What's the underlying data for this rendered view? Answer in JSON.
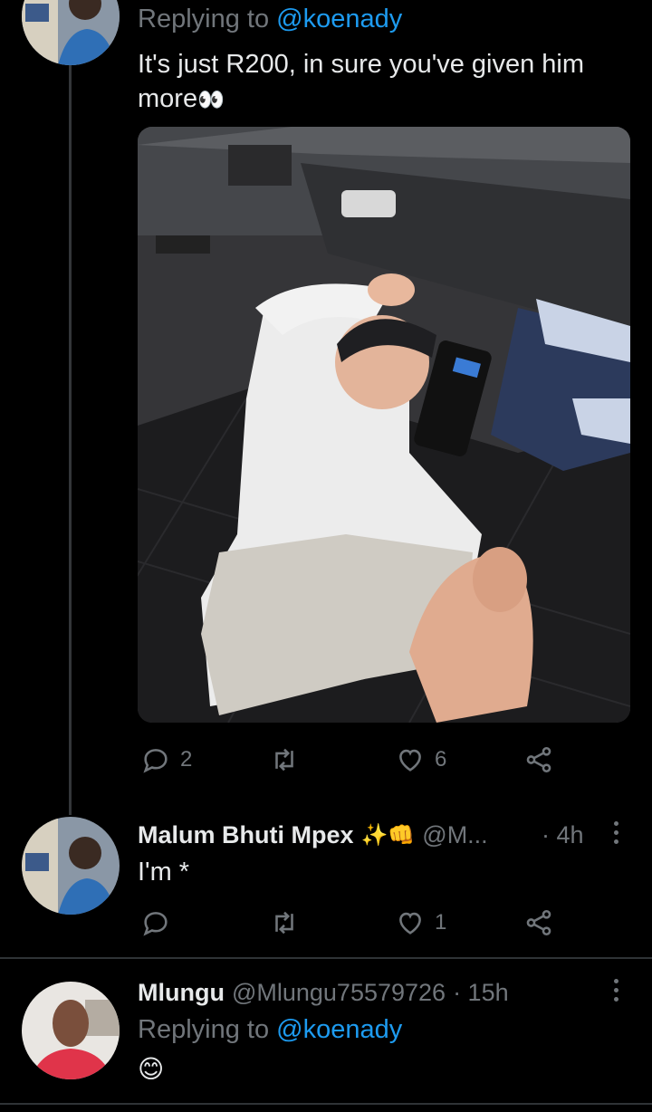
{
  "tweet1": {
    "replying_prefix": "Replying to",
    "replying_handle": "@koenady",
    "text_line1": "It's just R200, in sure you've given him",
    "text_line2": "more",
    "text_emoji": "👀",
    "media_alt": "photo",
    "actions": {
      "replies": "2",
      "retweets": "",
      "likes": "6"
    }
  },
  "tweet2": {
    "display_name": "Malum Bhuti Mpex",
    "name_emojis": "✨👊",
    "handle": "@M...",
    "time": "· 4h",
    "text": "I'm *",
    "actions": {
      "replies": "",
      "retweets": "",
      "likes": "1"
    }
  },
  "tweet3": {
    "display_name": "Mlungu",
    "handle": "@Mlungu75579726",
    "time": "· 15h",
    "replying_prefix": "Replying to",
    "replying_handle": "@koenady",
    "text": "😊"
  },
  "colors": {
    "accent": "#1d9bf0",
    "muted": "#71767b",
    "background": "#000000",
    "divider": "#2f3336"
  },
  "icons": [
    "reply-icon",
    "retweet-icon",
    "like-icon",
    "share-icon",
    "more-icon",
    "eyes-emoji",
    "smile-emoji"
  ]
}
